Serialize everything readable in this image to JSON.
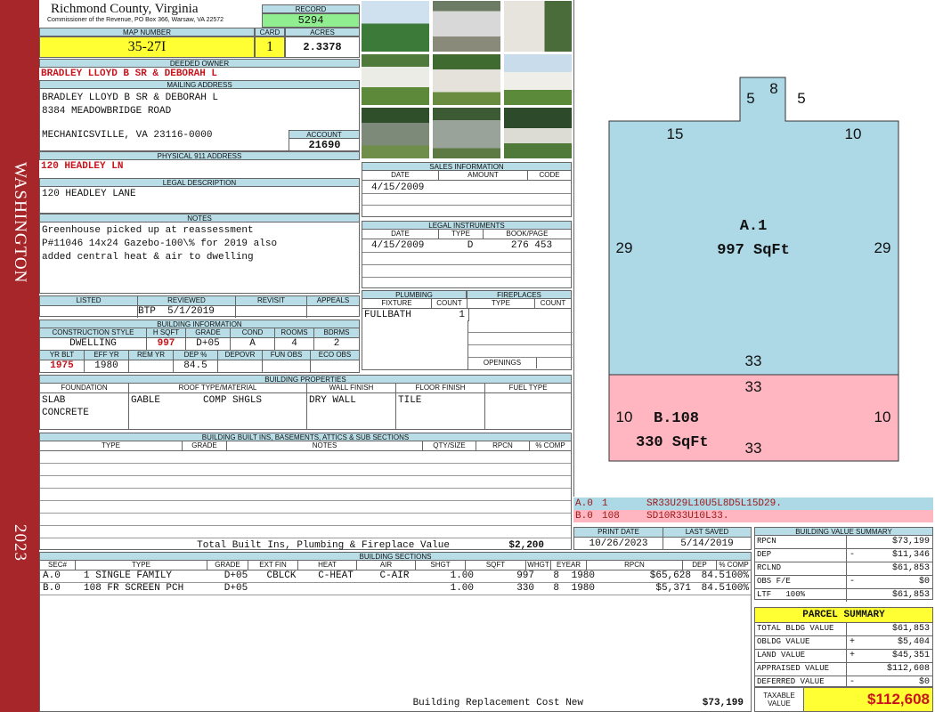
{
  "sidebar": {
    "district": "WASHINGTON",
    "year": "2023"
  },
  "header": {
    "county": "Richmond County, Virginia",
    "address": "Commissioner of the Revenue, PO Box 366, Warsaw, VA 22572",
    "record_label": "RECORD",
    "record": "5294",
    "map_label": "MAP NUMBER",
    "map": "35-27I",
    "card_label": "CARD",
    "card": "1",
    "acres_label": "ACRES",
    "acres": "2.3378"
  },
  "owner": {
    "deeded_label": "DEEDED OWNER",
    "deeded": "BRADLEY LLOYD B SR & DEBORAH L",
    "mailing_label": "MAILING ADDRESS",
    "mail1": "BRADLEY LLOYD B SR & DEBORAH L",
    "mail2": "8384 MEADOWBRIDGE ROAD",
    "mail3": "MECHANICSVILLE, VA 23116-0000",
    "account_label": "ACCOUNT",
    "account": "21690",
    "physical_label": "PHYSICAL 911 ADDRESS",
    "physical": "120 HEADLEY LN",
    "legal_label": "LEGAL DESCRIPTION",
    "legal": "120 HEADLEY LANE",
    "notes_label": "NOTES",
    "notes": [
      "Greenhouse picked up at reassessment",
      "P#11046 14x24 Gazebo-100\\% for 2019 also",
      "added central heat & air to dwelling"
    ]
  },
  "listing": {
    "h": [
      "LISTED",
      "REVIEWED",
      "REVISIT",
      "APPEALS"
    ],
    "reviewer": "BTP",
    "reviewed": "5/1/2019"
  },
  "building_info": {
    "label": "BUILDING INFORMATION",
    "h": [
      "CONSTRUCTION STYLE",
      "H SQFT",
      "GRADE",
      "COND",
      "ROOMS",
      "BDRMS"
    ],
    "v": [
      "DWELLING",
      "997",
      "D+05",
      "A",
      "4",
      "2"
    ],
    "h2": [
      "YR BLT",
      "EFF YR",
      "REM YR",
      "DEP %",
      "DEPOVR",
      "FUN OBS",
      "ECO OBS"
    ],
    "v2": [
      "1975",
      "1980",
      "",
      "84.5",
      "",
      "",
      ""
    ]
  },
  "properties": {
    "label": "BUILDING PROPERTIES",
    "h": [
      "FOUNDATION",
      "ROOF TYPE/MATERIAL",
      "WALL FINISH",
      "FLOOR FINISH",
      "FUEL TYPE"
    ],
    "foundation": [
      "SLAB",
      "CONCRETE"
    ],
    "roof1": "GABLE",
    "roof2": "COMP SHGLS",
    "wall": "DRY WALL",
    "floor": "TILE",
    "fuel": ""
  },
  "builtins": {
    "label": "BUILDING BUILT INS, BASEMENTS, ATTICS & SUB SECTIONS",
    "h": [
      "TYPE",
      "GRADE",
      "NOTES",
      "QTY/SIZE",
      "RPCN",
      "% COMP"
    ],
    "total_label": "Total Built Ins, Plumbing & Fireplace Value",
    "total": "$2,200"
  },
  "sales": {
    "label": "SALES INFORMATION",
    "h": [
      "DATE",
      "AMOUNT",
      "CODE"
    ],
    "date": "4/15/2009"
  },
  "legal_instr": {
    "label": "LEGAL INSTRUMENTS",
    "h": [
      "DATE",
      "TYPE",
      "BOOK/PAGE"
    ],
    "v": [
      "4/15/2009",
      "D",
      "276 453"
    ]
  },
  "plumbing": {
    "label": "PLUMBING",
    "h": [
      "FIXTURE",
      "COUNT"
    ],
    "v": [
      "FULLBATH",
      "1"
    ]
  },
  "fireplaces": {
    "label": "FIREPLACES",
    "h": [
      "TYPE",
      "COUNT"
    ],
    "openings": "OPENINGS"
  },
  "sketch": {
    "a_label": "A.1",
    "a_area": "997 SqFt",
    "b_label": "B.108",
    "b_area": "330 SqFt",
    "dims": {
      "top_notch": "8",
      "notch_left": "5",
      "notch_right": "5",
      "top_left": "15",
      "top_right": "10",
      "left": "29",
      "right": "29",
      "bottom_a": "33",
      "top_b": "33",
      "left_b": "10",
      "right_b": "10",
      "bottom_b": "33"
    },
    "code_a": [
      "A.0",
      "1",
      "SR33U29L10U5L8D5L15D29."
    ],
    "code_b": [
      "B.0",
      "108",
      "SD10R33U10L33."
    ],
    "colors": {
      "a": "#add8e6",
      "b": "#ffb6c1"
    }
  },
  "print": {
    "h": [
      "PRINT DATE",
      "LAST SAVED"
    ],
    "v": [
      "10/26/2023",
      "5/14/2019"
    ]
  },
  "sections": {
    "label": "BUILDING SECTIONS",
    "h": [
      "SEC#",
      "TYPE",
      "GRADE",
      "EXT FIN",
      "HEAT",
      "AIR",
      "SHGT",
      "SQFT",
      "WHGT",
      "EYEAR",
      "RPCN",
      "DEP",
      "% COMP"
    ],
    "rows": [
      [
        "A.0",
        "1 SINGLE FAMILY",
        "D+05",
        "CBLCK",
        "C-HEAT",
        "C-AIR",
        "1.00",
        "997",
        "8",
        "1980",
        "$65,628",
        "84.5",
        "100%"
      ],
      [
        "B.0",
        "108 FR SCREEN PCH",
        "D+05",
        "",
        "",
        "",
        "1.00",
        "330",
        "8",
        "1980",
        "$5,371",
        "84.5",
        "100%"
      ]
    ],
    "total_label": "Building Replacement Cost New",
    "total": "$73,199"
  },
  "value_summary": {
    "label": "BUILDING VALUE SUMMARY",
    "rows": [
      [
        "RPCN",
        "",
        "$73,199"
      ],
      [
        "DEP",
        "-",
        "$11,346"
      ],
      [
        "RCLND",
        "",
        "$61,853"
      ],
      [
        "OBS F/E",
        "-",
        "$0"
      ],
      [
        "LTF   100%",
        "",
        "$61,853"
      ]
    ]
  },
  "parcel": {
    "label": "PARCEL SUMMARY",
    "rows": [
      [
        "TOTAL BLDG VALUE",
        "",
        "$61,853"
      ],
      [
        "OBLDG VALUE",
        "+",
        "$5,404"
      ],
      [
        "LAND VALUE",
        "+",
        "$45,351"
      ],
      [
        "APPRAISED VALUE",
        "",
        "$112,608"
      ],
      [
        "DEFERRED VALUE",
        "-",
        "$0"
      ]
    ],
    "taxable_label": "TAXABLE VALUE",
    "taxable": "$112,608"
  }
}
